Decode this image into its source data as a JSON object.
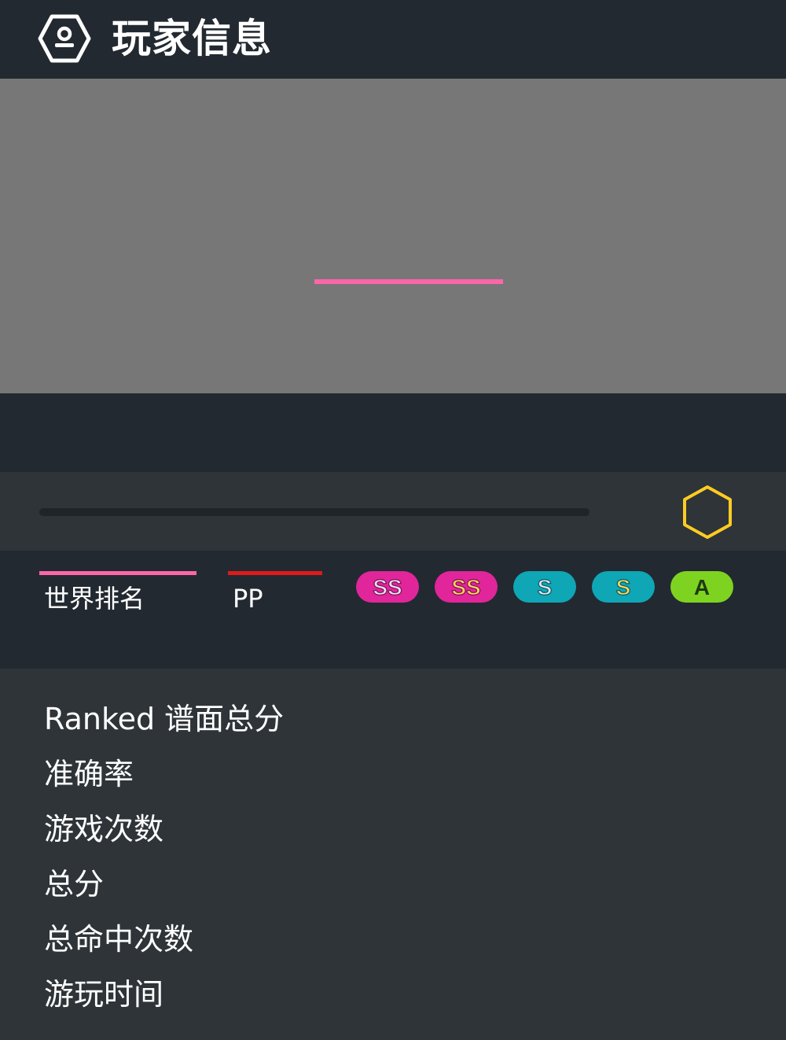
{
  "header": {
    "title": "玩家信息",
    "icon": "user-hexagon-icon"
  },
  "cover": {
    "loading_indicator_color": "#ff66aa"
  },
  "level": {
    "badge_icon": "level-hexagon-icon",
    "badge_color": "#ffcc22"
  },
  "stats": {
    "global_rank_label": "世界排名",
    "global_rank_color": "#ff66aa",
    "pp_label": "PP",
    "pp_color": "#e01a1a"
  },
  "grades": [
    {
      "name": "SS-silver",
      "letters": "SS",
      "bg": "#e1259a",
      "fg": "#e6e6f2"
    },
    {
      "name": "SS",
      "letters": "SS",
      "bg": "#e1259a",
      "fg": "#ffd75a"
    },
    {
      "name": "S-silver",
      "letters": "S",
      "bg": "#0fa6b5",
      "fg": "#e6e6f2"
    },
    {
      "name": "S",
      "letters": "S",
      "bg": "#0fa6b5",
      "fg": "#ffd75a"
    },
    {
      "name": "A",
      "letters": "A",
      "bg": "#7ed321",
      "fg": "#1f3a10"
    }
  ],
  "details": {
    "ranked_score": "Ranked 谱面总分",
    "accuracy": "准确率",
    "play_count": "游戏次数",
    "total_score": "总分",
    "total_hits": "总命中次数",
    "play_time": "游玩时间"
  }
}
